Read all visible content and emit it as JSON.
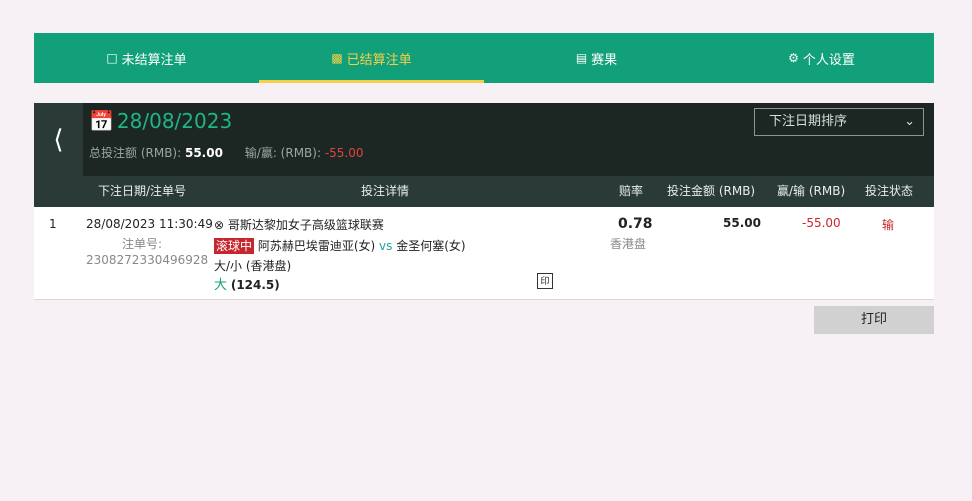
{
  "nav": {
    "tabs": [
      {
        "label": "未结算注单",
        "icon": "doc-check-icon"
      },
      {
        "label": "已结算注单",
        "icon": "clipboard-icon"
      },
      {
        "label": "赛果",
        "icon": "results-icon"
      },
      {
        "label": "个人设置",
        "icon": "gear-icon"
      }
    ]
  },
  "header": {
    "date": "28/08/2023",
    "total_label": "总投注额 (RMB):",
    "total_value": "55.00",
    "winloss_label": "输/赢: (RMB):",
    "winloss_value": "-55.00",
    "sort_label": "下注日期排序"
  },
  "table": {
    "headers": [
      "下注日期/注单号",
      "投注详情",
      "赔率",
      "投注金额 (RMB)",
      "赢/输 (RMB)",
      "投注状态"
    ],
    "rows": [
      {
        "index": "1",
        "datetime": "28/08/2023 11:30:49",
        "ticket_label": "注单号:",
        "ticket_no": "2308272330496928",
        "league": "哥斯达黎加女子高级篮球联赛",
        "live_tag": "滚球中",
        "home": "阿苏赫巴埃雷迪亚(女)",
        "vs": "vs",
        "away": "金圣何塞(女)",
        "market": "大/小 (香港盘)",
        "selection": "大",
        "line": "(124.5)",
        "odds": "0.78",
        "odds_type": "香港盘",
        "stake": "55.00",
        "result": "-55.00",
        "status": "输",
        "print_glyph": "印"
      }
    ]
  },
  "print_button": "打印"
}
